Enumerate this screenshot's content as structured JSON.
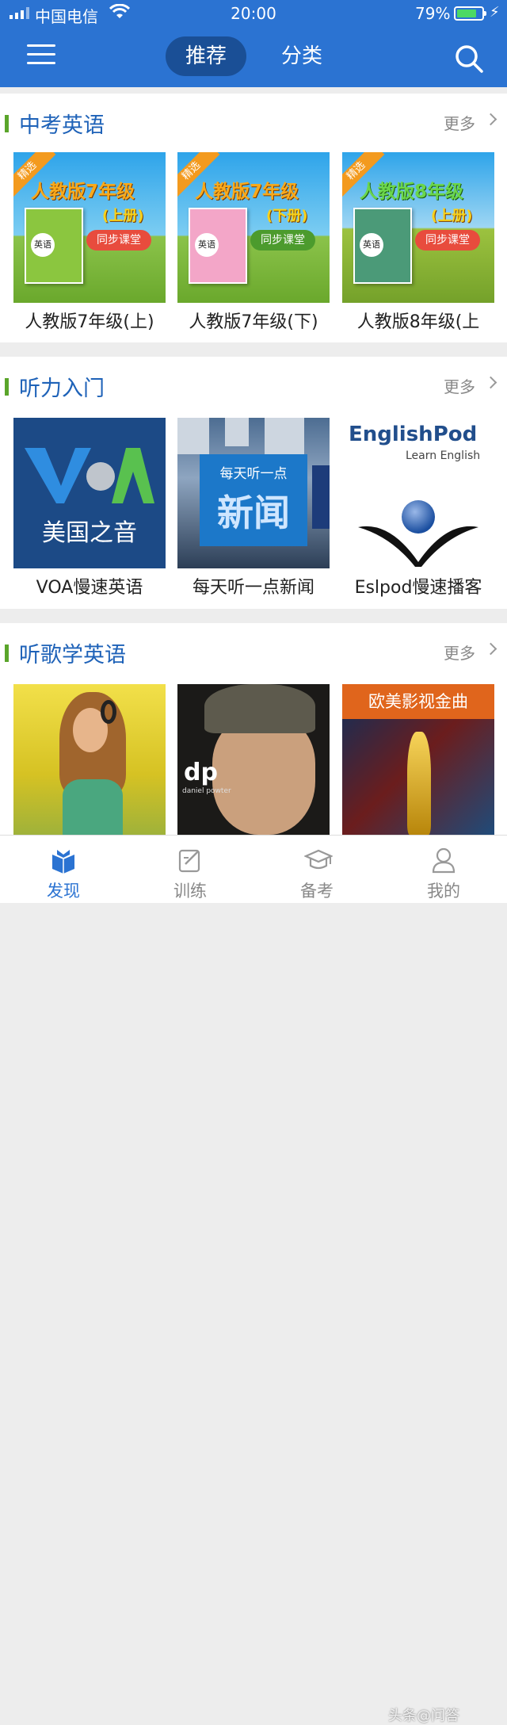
{
  "status_bar": {
    "carrier": "中国电信",
    "time": "20:00",
    "battery_percent": "79%",
    "battery_level": 0.79
  },
  "header": {
    "tabs": [
      {
        "label": "推荐",
        "active": true
      },
      {
        "label": "分类",
        "active": false
      }
    ],
    "menu_icon": "hamburger-icon",
    "search_icon": "search-icon",
    "color": "#2b73d2"
  },
  "sections": [
    {
      "title": "中考英语",
      "more_label": "更多",
      "items": [
        {
          "caption": "人教版7年级(上)",
          "thumb_title": "人教版7年级",
          "thumb_sub": "(上册)",
          "badge": "精选",
          "pill": "同步课堂",
          "book_word": "英语"
        },
        {
          "caption": "人教版7年级(下)",
          "thumb_title": "人教版7年级",
          "thumb_sub": "(下册)",
          "badge": "精选",
          "pill": "同步课堂",
          "book_word": "英语"
        },
        {
          "caption": "人教版8年级(上",
          "thumb_title": "人教版8年级",
          "thumb_sub": "(上册)",
          "badge": "精选",
          "pill": "同步课堂",
          "book_word": "英语"
        }
      ]
    },
    {
      "title": "听力入门",
      "more_label": "更多",
      "items": [
        {
          "caption": "VOA慢速英语",
          "thumb_text": "美国之音"
        },
        {
          "caption": "每天听一点新闻",
          "thumb_text_1": "每天听一点",
          "thumb_text_2": "新闻"
        },
        {
          "caption": "Eslpod慢速播客",
          "thumb_brand": "EnglishPod",
          "thumb_sub": "Learn English"
        }
      ]
    },
    {
      "title": "听歌学英语",
      "more_label": "更多",
      "items": [
        {
          "thumb": "woman-headphones-photo"
        },
        {
          "thumb": "daniel-powter-photo",
          "logo": "dp",
          "logo_sub": "daniel powter"
        },
        {
          "thumb": "movie-songs-poster",
          "thumb_text": "欧美影视金曲"
        }
      ]
    }
  ],
  "bottom_nav": [
    {
      "label": "发现",
      "icon": "book-icon",
      "active": true
    },
    {
      "label": "训练",
      "icon": "edit-icon",
      "active": false
    },
    {
      "label": "备考",
      "icon": "graduation-cap-icon",
      "active": false
    },
    {
      "label": "我的",
      "icon": "user-icon",
      "active": false
    }
  ],
  "watermark": "头条@问答"
}
